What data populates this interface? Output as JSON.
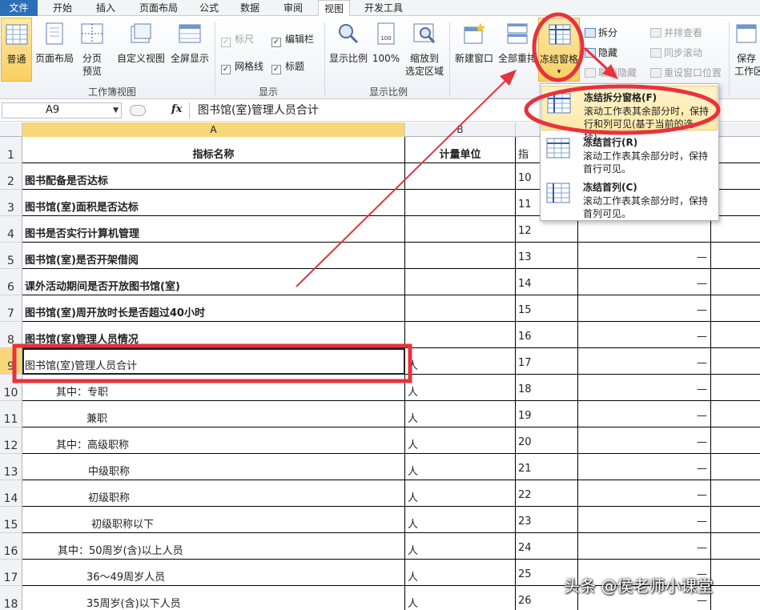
{
  "menu_tabs": [
    "文件",
    "开始",
    "插入",
    "页面布局",
    "公式",
    "数据",
    "审阅",
    "视图",
    "开发工具"
  ],
  "ribbon": {
    "workbook_views": {
      "normal": "普通",
      "page_layout": "页面布局",
      "page_break": [
        "分页",
        "预览"
      ],
      "custom_views": "自定义视图",
      "full_screen": "全屏显示",
      "group_label": "工作簿视图"
    },
    "show": {
      "ruler": "标尺",
      "formula_bar": "编辑栏",
      "gridlines": "网格线",
      "headings": "标题",
      "group_label": "显示"
    },
    "zoom": {
      "zoom": "显示比例",
      "hundred": "100%",
      "zoom_to_selection": [
        "缩放到",
        "选定区域"
      ],
      "group_label": "显示比例"
    },
    "window": {
      "new_window": "新建窗口",
      "arrange_all": "全部重排",
      "freeze_panes": "冻结窗格",
      "split": "拆分",
      "hide": "隐藏",
      "unhide": "取消隐藏",
      "view_side_by_side": "并排查看",
      "sync_scroll": "同步滚动",
      "reset_position": "重设窗口位置",
      "save_workspace": [
        "保存",
        "工作区"
      ]
    }
  },
  "formula_bar": {
    "name_box": "A9",
    "fx": "fx",
    "content": "图书馆(室)管理人员合计"
  },
  "columns": [
    "A",
    "B"
  ],
  "rows": [
    {
      "num": "1",
      "a": "指标名称",
      "b": "计量单位",
      "c": "指",
      "d": "",
      "e": "",
      "header": true
    },
    {
      "num": "2",
      "a": "图书配备是否达标",
      "b": "",
      "c": "10",
      "d": "",
      "e": "",
      "bold": true
    },
    {
      "num": "3",
      "a": "图书馆(室)面积是否达标",
      "b": "",
      "c": "11",
      "d": "",
      "e": "",
      "bold": true
    },
    {
      "num": "4",
      "a": "图书是否实行计算机管理",
      "b": "",
      "c": "12",
      "d": "",
      "e": "",
      "bold": true
    },
    {
      "num": "5",
      "a": "图书馆(室)是否开架借阅",
      "b": "",
      "c": "13",
      "d": "—",
      "e": "",
      "bold": true
    },
    {
      "num": "6",
      "a": "课外活动期间是否开放图书馆(室)",
      "b": "",
      "c": "14",
      "d": "—",
      "e": "",
      "bold": true
    },
    {
      "num": "7",
      "a": "图书馆(室)周开放时长是否超过40小时",
      "b": "",
      "c": "15",
      "d": "—",
      "e": "",
      "bold": true
    },
    {
      "num": "8",
      "a": "图书馆(室)管理人员情况",
      "b": "",
      "c": "16",
      "d": "—",
      "e": "",
      "bold": true
    },
    {
      "num": "9",
      "a": "图书馆(室)管理人员合计",
      "b": "人",
      "c": "17",
      "d": "—",
      "e": "",
      "selected": true
    },
    {
      "num": "10",
      "a": "其中：专职",
      "b": "人",
      "c": "18",
      "d": "—",
      "e": "",
      "indent": 42
    },
    {
      "num": "11",
      "a": "兼职",
      "b": "人",
      "c": "19",
      "d": "—",
      "e": "",
      "indent": 80
    },
    {
      "num": "12",
      "a": "其中：高级职称",
      "b": "人",
      "c": "20",
      "d": "—",
      "e": "",
      "indent": 42
    },
    {
      "num": "13",
      "a": "中级职称",
      "b": "人",
      "c": "21",
      "d": "—",
      "e": "",
      "indent": 82
    },
    {
      "num": "14",
      "a": "初级职称",
      "b": "人",
      "c": "22",
      "d": "—",
      "e": "",
      "indent": 82
    },
    {
      "num": "15",
      "a": "初级职称以下",
      "b": "人",
      "c": "23",
      "d": "—",
      "e": "",
      "indent": 86
    },
    {
      "num": "16",
      "a": "其中：50周岁(含)以上人员",
      "b": "人",
      "c": "24",
      "d": "—",
      "e": "",
      "indent": 44
    },
    {
      "num": "17",
      "a": "36～49周岁人员",
      "b": "人",
      "c": "25",
      "d": "—",
      "e": "",
      "indent": 80
    },
    {
      "num": "18",
      "a": "35周岁(含)以下人员",
      "b": "人",
      "c": "26",
      "d": "—",
      "e": "",
      "indent": 80
    }
  ],
  "dropdown": [
    {
      "title": "冻结拆分窗格(F)",
      "desc": "滚动工作表其余部分时，保持行和列可见(基于当前的选择)。"
    },
    {
      "title": "冻结首行(R)",
      "desc": "滚动工作表其余部分时，保持首行可见。"
    },
    {
      "title": "冻结首列(C)",
      "desc": "滚动工作表其余部分时，保持首列可见。"
    }
  ],
  "watermark": "头条 @侯老师小课堂",
  "colors": {
    "accent": "#2c6fb9",
    "highlight": "#f7d67a",
    "annotation": "#e8323c"
  }
}
